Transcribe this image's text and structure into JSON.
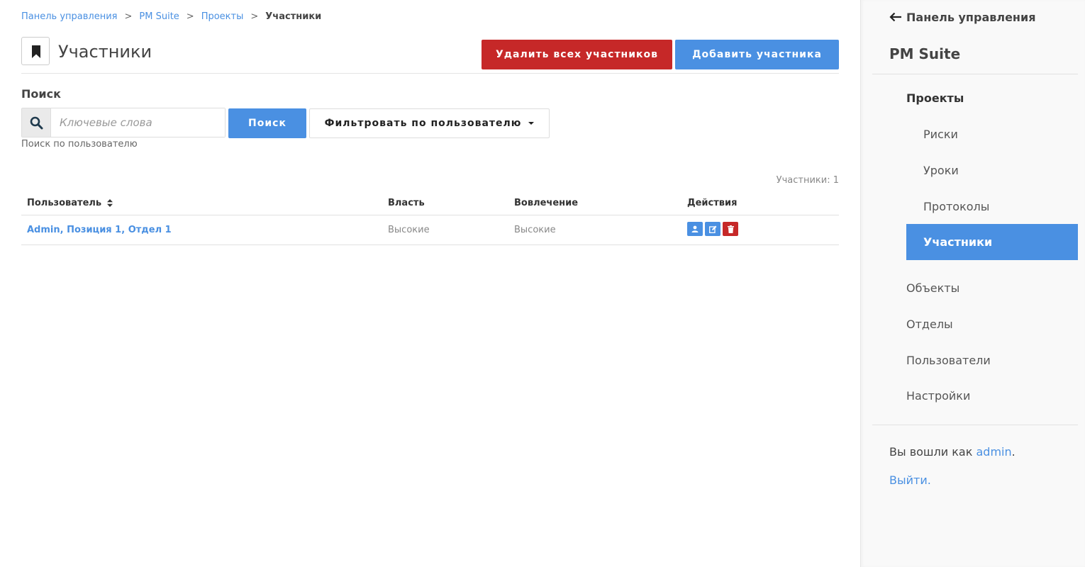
{
  "breadcrumb": {
    "items": [
      "Панель управления",
      "PM Suite",
      "Проекты"
    ],
    "current": "Участники",
    "separator": ">"
  },
  "header": {
    "icon": "bookmark-icon",
    "title": "Участники",
    "delete_all_label": "Удалить всех участников",
    "add_label": "Добавить участника"
  },
  "search": {
    "label": "Поиск",
    "icon": "search-icon",
    "placeholder": "Ключевые слова",
    "value": "",
    "button_label": "Поиск",
    "filter_label": "Фильтровать по пользователю",
    "help_text": "Поиск по пользователю"
  },
  "count_text": "Участники: 1",
  "table": {
    "headers": {
      "user": "Пользователь",
      "power": "Власть",
      "involvement": "Вовлечение",
      "actions": "Действия"
    },
    "rows": [
      {
        "user": "Admin, Позиция 1, Отдел 1",
        "power": "Высокие",
        "involvement": "Высокие",
        "actions": [
          "user-icon",
          "edit-icon",
          "trash-icon"
        ]
      }
    ]
  },
  "sidebar": {
    "back_label": "Панель управления",
    "app_title": "PM Suite",
    "group_label": "Проекты",
    "sub_items": [
      "Риски",
      "Уроки",
      "Протоколы",
      "Участники"
    ],
    "active_item": "Участники",
    "top_items": [
      "Объекты",
      "Отделы",
      "Пользователи",
      "Настройки"
    ],
    "logged_prefix": "Вы вошли как ",
    "user_name": "admin",
    "logged_suffix": ".",
    "logout_label": "Выйти."
  },
  "colors": {
    "primary": "#4a90e2",
    "danger": "#c62828",
    "text": "#444444"
  }
}
